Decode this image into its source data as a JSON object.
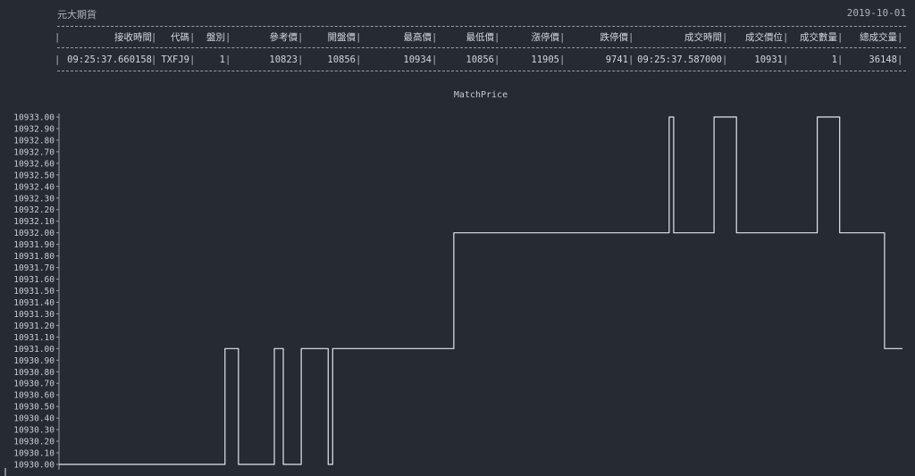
{
  "header": {
    "title": "元大期貨",
    "date": "2019-10-01"
  },
  "table": {
    "columns": [
      "接收時間",
      "代碼",
      "盤別",
      "參考價",
      "開盤價",
      "最高價",
      "最低價",
      "漲停價",
      "跌停價",
      "成交時間",
      "成交價位",
      "成交數量",
      "總成交量"
    ],
    "row": [
      "09:25:37.660158",
      "TXFJ9",
      "1",
      "10823",
      "10856",
      "10934",
      "10856",
      "11905",
      "9741",
      "09:25:37.587000",
      "10931",
      "1",
      "36148"
    ]
  },
  "chart_data": {
    "type": "line",
    "title": "MatchPrice",
    "xlabel": "",
    "ylabel": "",
    "ylim": [
      10930.0,
      10933.0
    ],
    "yticks": [
      "10933.00",
      "10932.90",
      "10932.80",
      "10932.70",
      "10932.60",
      "10932.50",
      "10932.40",
      "10932.30",
      "10932.20",
      "10932.10",
      "10932.00",
      "10931.90",
      "10931.80",
      "10931.70",
      "10931.60",
      "10931.50",
      "10931.40",
      "10931.30",
      "10931.20",
      "10931.10",
      "10931.00",
      "10930.90",
      "10930.80",
      "10930.70",
      "10930.60",
      "10930.50",
      "10930.40",
      "10930.30",
      "10930.20",
      "10930.10",
      "10930.00"
    ],
    "series": [
      {
        "values": [
          10930,
          10930,
          10930,
          10930,
          10930,
          10930,
          10930,
          10930,
          10930,
          10930,
          10930,
          10930,
          10930,
          10930,
          10930,
          10930,
          10930,
          10930,
          10930,
          10930,
          10930,
          10930,
          10930,
          10930,
          10930,
          10930,
          10930,
          10930,
          10930,
          10930,
          10930,
          10930,
          10930,
          10930,
          10930,
          10930,
          10930,
          10931,
          10931,
          10931,
          10930,
          10930,
          10930,
          10930,
          10930,
          10930,
          10930,
          10930,
          10931,
          10931,
          10930,
          10930,
          10930,
          10930,
          10931,
          10931,
          10931,
          10931,
          10931,
          10931,
          10930,
          10931,
          10931,
          10931,
          10931,
          10931,
          10931,
          10931,
          10931,
          10931,
          10931,
          10931,
          10931,
          10931,
          10931,
          10931,
          10931,
          10931,
          10931,
          10931,
          10931,
          10931,
          10931,
          10931,
          10931,
          10931,
          10931,
          10931,
          10932,
          10932,
          10932,
          10932,
          10932,
          10932,
          10932,
          10932,
          10932,
          10932,
          10932,
          10932,
          10932,
          10932,
          10932,
          10932,
          10932,
          10932,
          10932,
          10932,
          10932,
          10932,
          10932,
          10932,
          10932,
          10932,
          10932,
          10932,
          10932,
          10932,
          10932,
          10932,
          10932,
          10932,
          10932,
          10932,
          10932,
          10932,
          10932,
          10932,
          10932,
          10932,
          10932,
          10932,
          10932,
          10932,
          10932,
          10932,
          10933,
          10932,
          10932,
          10932,
          10932,
          10932,
          10932,
          10932,
          10932,
          10932,
          10933,
          10933,
          10933,
          10933,
          10933,
          10932,
          10932,
          10932,
          10932,
          10932,
          10932,
          10932,
          10932,
          10932,
          10932,
          10932,
          10932,
          10932,
          10932,
          10932,
          10932,
          10932,
          10932,
          10933,
          10933,
          10933,
          10933,
          10933,
          10932,
          10932,
          10932,
          10932,
          10932,
          10932,
          10932,
          10932,
          10932,
          10932,
          10931,
          10931,
          10931,
          10931
        ]
      }
    ],
    "line_color": "#e3e6ea",
    "grid": false,
    "legend": "none"
  },
  "colors": {
    "background": "#252a33",
    "text": "#c9cdd3",
    "line": "#e3e6ea"
  }
}
